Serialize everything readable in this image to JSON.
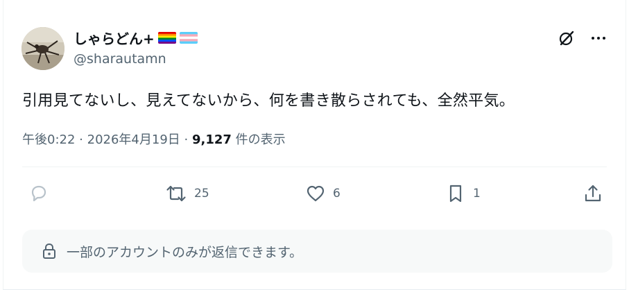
{
  "tweet": {
    "display_name": "しゃらどん+",
    "handle": "@sharautamn",
    "text": "引用見てないし、見えてないから、何を書き散らされても、全然平気。",
    "time": "午後0:22",
    "date": "2026年4月19日",
    "separator": "·",
    "views_count": "9,127",
    "views_label": "件の表示"
  },
  "actions": {
    "reply_count": "",
    "retweet_count": "25",
    "like_count": "6",
    "bookmark_count": "1"
  },
  "reply_notice": {
    "text": "一部のアカウントのみが返信できます。"
  },
  "colors": {
    "text_primary": "#0f1419",
    "text_secondary": "#536471",
    "icon_light": "#b8c2ca",
    "notice_bg": "#f7f9f9"
  }
}
